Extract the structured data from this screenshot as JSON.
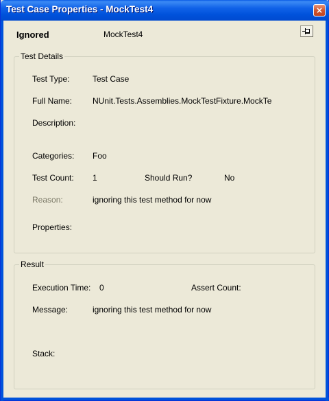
{
  "window": {
    "title": "Test Case Properties - MockTest4",
    "close_glyph": "×"
  },
  "header": {
    "status": "Ignored",
    "test_name": "MockTest4",
    "pin_icon": "pin-icon"
  },
  "test_details": {
    "group_label": "Test Details",
    "test_type_label": "Test Type:",
    "test_type_value": "Test Case",
    "full_name_label": "Full Name:",
    "full_name_value": "NUnit.Tests.Assemblies.MockTestFixture.MockTe",
    "description_label": "Description:",
    "description_value": "",
    "categories_label": "Categories:",
    "categories_value": "Foo",
    "test_count_label": "Test Count:",
    "test_count_value": "1",
    "should_run_label": "Should Run?",
    "should_run_value": "No",
    "reason_label": "Reason:",
    "reason_value": "ignoring this test method for now",
    "properties_label": "Properties:",
    "properties_value": ""
  },
  "result": {
    "group_label": "Result",
    "execution_time_label": "Execution Time:",
    "execution_time_value": "0",
    "assert_count_label": "Assert Count:",
    "assert_count_value": "",
    "message_label": "Message:",
    "message_value": "ignoring this test method for now",
    "stack_label": "Stack:",
    "stack_value": ""
  },
  "colors": {
    "titlebar": "#0052db",
    "dialog_bg": "#ece9d8",
    "disabled_text": "#7a7866"
  }
}
